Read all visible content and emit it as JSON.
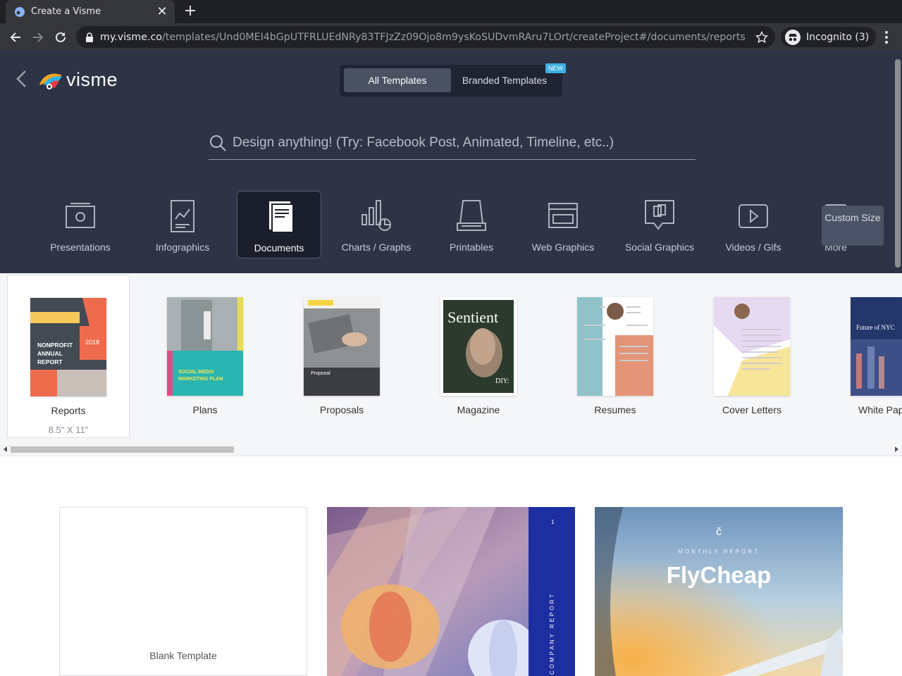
{
  "browser": {
    "tab_title": "Create a Visme",
    "url_host": "my.visme.co",
    "url_path": "/templates/Und0MEI4bGpUTFRLUEdNRy83TFJzZz09Ojo8m9ysKoSUDvmRAru7LOrt/createProject#/documents/reports",
    "profile_label": "Incognito (3)"
  },
  "header": {
    "logo_text": "visme",
    "switch": {
      "all": "All Templates",
      "branded": "Branded Templates",
      "badge": "NEW"
    },
    "search_placeholder": "Design anything! (Try: Facebook Post, Animated, Timeline, etc..)",
    "categories": [
      {
        "label": "Presentations",
        "icon": "presentation-icon"
      },
      {
        "label": "Infographics",
        "icon": "infographic-icon"
      },
      {
        "label": "Documents",
        "icon": "document-icon",
        "active": true
      },
      {
        "label": "Charts / Graphs",
        "icon": "chart-icon"
      },
      {
        "label": "Printables",
        "icon": "printer-icon"
      },
      {
        "label": "Web Graphics",
        "icon": "web-icon"
      },
      {
        "label": "Social Graphics",
        "icon": "social-icon"
      },
      {
        "label": "Videos / Gifs",
        "icon": "video-icon"
      },
      {
        "label": "More",
        "icon": "more-icon"
      }
    ],
    "custom_size": "Custom Size"
  },
  "subcategories": [
    {
      "label": "Reports",
      "size": "8.5\" X 11\"",
      "active": true
    },
    {
      "label": "Plans"
    },
    {
      "label": "Proposals"
    },
    {
      "label": "Magazine"
    },
    {
      "label": "Resumes"
    },
    {
      "label": "Cover Letters"
    },
    {
      "label": "White Pap"
    }
  ],
  "thumb_text": {
    "report": [
      "NONPROFIT",
      "ANNUAL",
      "REPORT",
      "2018"
    ],
    "plan": "SOCIAL MEDIA MARKETING PLAN",
    "proposal": "Proposal",
    "magazine": [
      "Sentient",
      "DIY:"
    ],
    "whitepaper": "Future of NYC"
  },
  "templates": {
    "blank": "Blank Template",
    "t2_vertical": "COMPANY REPORT",
    "t3_kicker": "MONTHLY REPORT",
    "t3_title": "FlyCheap"
  },
  "colors": {
    "hero": "#2e3446",
    "accent_badge": "#3bb0e0"
  }
}
